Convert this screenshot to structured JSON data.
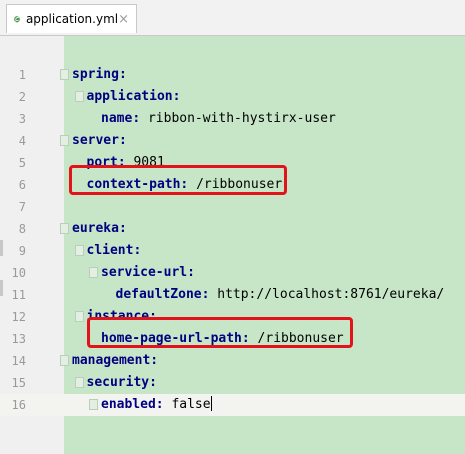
{
  "tab": {
    "filename": "application.yml",
    "icon": "yaml-file-icon",
    "close_glyph": "×"
  },
  "editor": {
    "current_line": 16,
    "lines": [
      {
        "num": "1",
        "indent": 0,
        "key": "spring",
        "sep": ":",
        "value": ""
      },
      {
        "num": "2",
        "indent": 1,
        "key": "application",
        "sep": ":",
        "value": ""
      },
      {
        "num": "3",
        "indent": 2,
        "key": "name",
        "sep": ":",
        "value": " ribbon-with-hystirx-user"
      },
      {
        "num": "4",
        "indent": 0,
        "key": "server",
        "sep": ":",
        "value": ""
      },
      {
        "num": "5",
        "indent": 1,
        "key": "port",
        "sep": ":",
        "value": " 9081"
      },
      {
        "num": "6",
        "indent": 1,
        "key": "context-path",
        "sep": ":",
        "value": " /ribbonuser"
      },
      {
        "num": "7",
        "indent": 0,
        "key": "",
        "sep": "",
        "value": ""
      },
      {
        "num": "8",
        "indent": 0,
        "key": "eureka",
        "sep": ":",
        "value": ""
      },
      {
        "num": "9",
        "indent": 1,
        "key": "client",
        "sep": ":",
        "value": ""
      },
      {
        "num": "10",
        "indent": 2,
        "key": "service-url",
        "sep": ":",
        "value": ""
      },
      {
        "num": "11",
        "indent": 3,
        "key": "defaultZone",
        "sep": ":",
        "value": " http://localhost:8761/eureka/"
      },
      {
        "num": "12",
        "indent": 1,
        "key": "instance",
        "sep": ":",
        "value": ""
      },
      {
        "num": "13",
        "indent": 2,
        "key": "home-page-url-path",
        "sep": ":",
        "value": " /ribbonuser"
      },
      {
        "num": "14",
        "indent": 0,
        "key": "management",
        "sep": ":",
        "value": ""
      },
      {
        "num": "15",
        "indent": 1,
        "key": "security",
        "sep": ":",
        "value": ""
      },
      {
        "num": "16",
        "indent": 2,
        "key": "enabled",
        "sep": ":",
        "value": " false"
      }
    ]
  },
  "highlight_color": "#e3131b",
  "code_background": "#c7e6c7"
}
